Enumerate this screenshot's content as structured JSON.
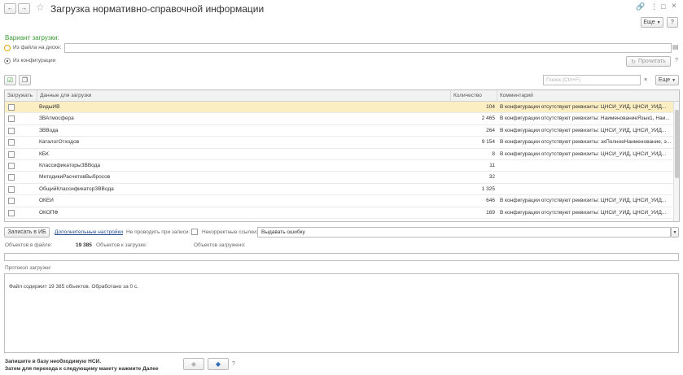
{
  "window": {
    "title": "Загрузка нормативно-справочной информации",
    "more_label": "Еще",
    "help_label": "?"
  },
  "variant": {
    "heading": "Вариант загрузки:",
    "from_file_label": "Из файла на диске:",
    "from_config_label": "Из конфигурации",
    "read_label": "Прочитать",
    "help_label": "?"
  },
  "toolbar": {
    "search_placeholder": "Поиск (Ctrl+F)",
    "clear_label": "×",
    "more_label": "Еще"
  },
  "table": {
    "columns": [
      "Загружать",
      "Данные для загрузки",
      "Количество",
      "Комментарий"
    ],
    "rows": [
      {
        "name": "ВидыИВ",
        "count": "104",
        "comment": "В конфигурации отсутствуют реквизиты: ЦНСИ_УИД, ЦНСИ_УИД...",
        "selected": true
      },
      {
        "name": "ЗВАтмосфера",
        "count": "2 465",
        "comment": "В конфигурации отсутствуют реквизиты: НаименованиеЯзык1, Наи...",
        "selected": false
      },
      {
        "name": "ЗВВода",
        "count": "264",
        "comment": "В конфигурации отсутствуют реквизиты: ЦНСИ_УИД, ЦНСИ_УИД...",
        "selected": false
      },
      {
        "name": "КаталогОтходов",
        "count": "9 154",
        "comment": "В конфигурации отсутствуют реквизиты: экПолноеНаименование, э...",
        "selected": false
      },
      {
        "name": "КБК",
        "count": "8",
        "comment": "В конфигурации отсутствуют реквизиты: ЦНСИ_УИД, ЦНСИ_УИД...",
        "selected": false
      },
      {
        "name": "КлассификаторыЗВВода",
        "count": "11",
        "comment": "",
        "selected": false
      },
      {
        "name": "МетодикиРасчетовВыбросов",
        "count": "32",
        "comment": "",
        "selected": false
      },
      {
        "name": "ОбщийКлассификаторЗВВода",
        "count": "1 325",
        "comment": "",
        "selected": false
      },
      {
        "name": "ОКЕИ",
        "count": "646",
        "comment": "В конфигурации отсутствуют реквизиты: ЦНСИ_УИД, ЦНСИ_УИД...",
        "selected": false
      },
      {
        "name": "ОКОПФ",
        "count": "169",
        "comment": "В конфигурации отсутствуют реквизиты: ЦНСИ_УИД, ЦНСИ_УИД...",
        "selected": false
      }
    ]
  },
  "actions": {
    "write_label": "Записать в ИБ",
    "extra_settings_label": "Дополнительные настройки",
    "no_post_label": "Не проводить при записи:",
    "bad_links_label": "Некорректные ссылки:",
    "bad_links_value": "Выдавать ошибку"
  },
  "stats": {
    "in_file_label": "Объектов в файле:",
    "in_file_value": "19 385",
    "to_load_label": "Объектов к загрузке:",
    "loaded_label": "Объектов загружено:"
  },
  "log": {
    "label": "Протокол загрузки:",
    "text": "Файл содержит 19 385 объектов. Обработано за 0 с."
  },
  "footer": {
    "line1": "Запишите в базу необходимую НСИ.",
    "line2": "Затем для перехода к следующему макету нажмите Далее",
    "help": "?"
  }
}
